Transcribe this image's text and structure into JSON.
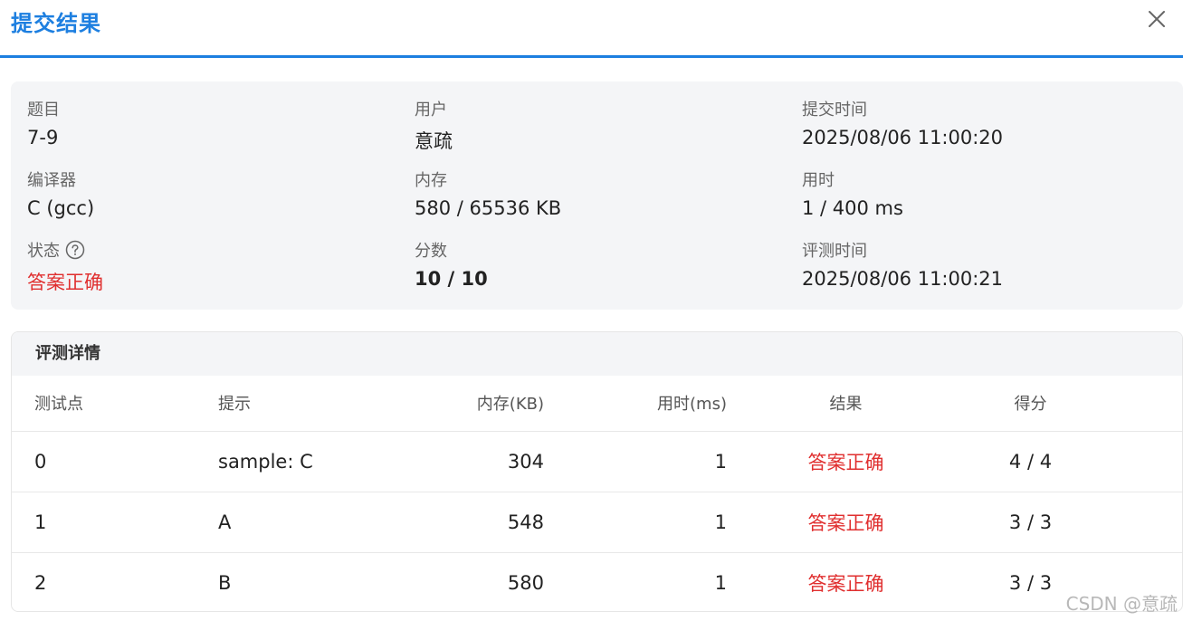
{
  "dialog": {
    "title": "提交结果"
  },
  "info": {
    "problem": {
      "label": "题目",
      "value": "7-9"
    },
    "user": {
      "label": "用户",
      "value": "意疏"
    },
    "submit_time": {
      "label": "提交时间",
      "value": "2025/08/06 11:00:20"
    },
    "compiler": {
      "label": "编译器",
      "value": "C (gcc)"
    },
    "memory": {
      "label": "内存",
      "value": "580 / 65536 KB"
    },
    "time_used": {
      "label": "用时",
      "value": "1 / 400 ms"
    },
    "status": {
      "label": "状态",
      "value": "答案正确",
      "color": "#e02f2f"
    },
    "score": {
      "label": "分数",
      "value": "10 / 10"
    },
    "judge_time": {
      "label": "评测时间",
      "value": "2025/08/06 11:00:21"
    }
  },
  "details": {
    "title": "评测详情",
    "columns": [
      "测试点",
      "提示",
      "内存(KB)",
      "用时(ms)",
      "结果",
      "得分"
    ],
    "rows": [
      {
        "id": "0",
        "hint": "sample: C",
        "memory": "304",
        "time": "1",
        "result": "答案正确",
        "score": "4 / 4"
      },
      {
        "id": "1",
        "hint": "A",
        "memory": "548",
        "time": "1",
        "result": "答案正确",
        "score": "3 / 3"
      },
      {
        "id": "2",
        "hint": "B",
        "memory": "580",
        "time": "1",
        "result": "答案正确",
        "score": "3 / 3"
      }
    ]
  },
  "watermark": "CSDN @意疏",
  "colors": {
    "accent": "#1d7fe0",
    "success_text": "#e02f2f",
    "card_bg": "#f4f5f7"
  },
  "icons": {
    "close": "close-icon",
    "help": "help-circle-icon"
  }
}
